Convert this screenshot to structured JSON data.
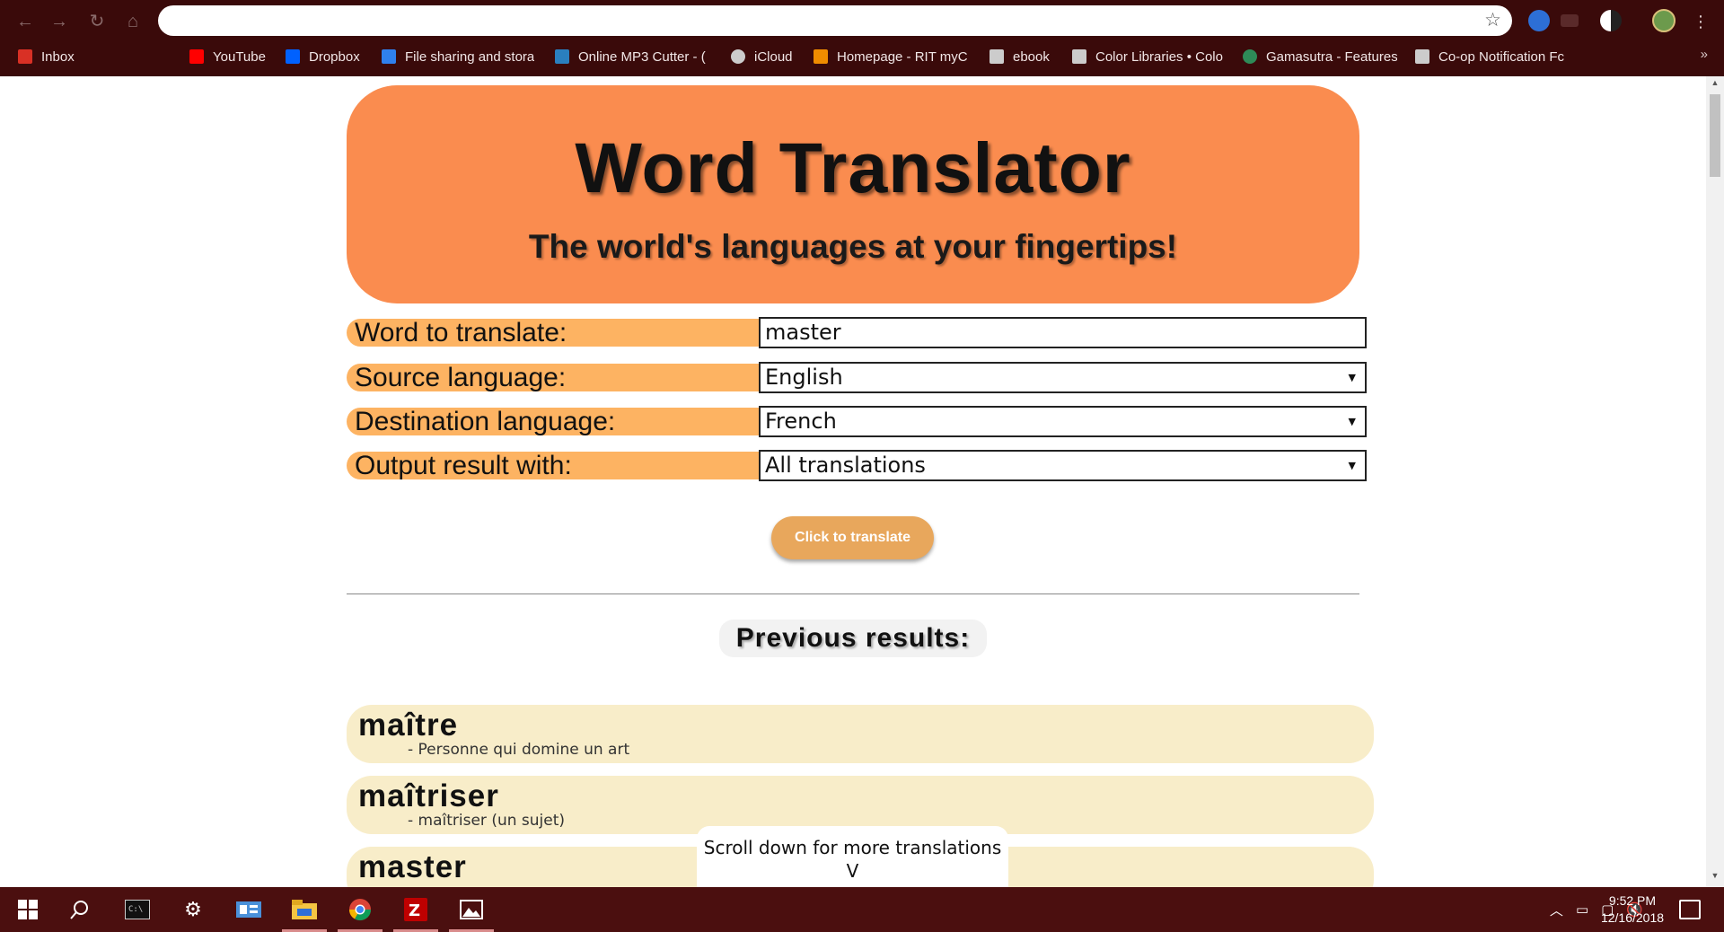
{
  "browser": {
    "url": "",
    "bookmarks": [
      {
        "label": "Inbox",
        "icon": "gmail-icon",
        "color": "#d93025"
      },
      {
        "label": "YouTube",
        "icon": "youtube-icon",
        "color": "#ff0000"
      },
      {
        "label": "Dropbox",
        "icon": "dropbox-icon",
        "color": "#0061ff"
      },
      {
        "label": "File sharing and stora",
        "icon": "file-sharing-icon",
        "color": "#2f80ed"
      },
      {
        "label": "Online MP3 Cutter - (",
        "icon": "mp3-cutter-icon",
        "color": "#2a7fbf"
      },
      {
        "label": "iCloud",
        "icon": "apple-icon",
        "color": "#cccccc"
      },
      {
        "label": "Homepage - RIT myC",
        "icon": "rit-icon",
        "color": "#f08c00"
      },
      {
        "label": "ebook",
        "icon": "page-icon",
        "color": "#cccccc"
      },
      {
        "label": "Color Libraries • Colo",
        "icon": "page-icon",
        "color": "#cccccc"
      },
      {
        "label": "Gamasutra - Features",
        "icon": "gamasutra-icon",
        "color": "#2e8b57"
      },
      {
        "label": "Co-op Notification Fc",
        "icon": "page-icon",
        "color": "#cccccc"
      }
    ],
    "more": "»"
  },
  "header": {
    "title": "Word Translator",
    "subtitle": "The world's languages at your fingertips!"
  },
  "form": {
    "word": {
      "label": "Word to translate:",
      "value": "master"
    },
    "source": {
      "label": "Source language:",
      "value": "English"
    },
    "destination": {
      "label": "Destination language:",
      "value": "French"
    },
    "output": {
      "label": "Output result with:",
      "value": "All translations"
    },
    "button_label": "Click to translate"
  },
  "results": {
    "heading": "Previous results:",
    "items": [
      {
        "word": "maître",
        "definition": "- Personne qui domine un art"
      },
      {
        "word": "maîtriser",
        "definition": "- maîtriser (un sujet)"
      },
      {
        "word": "master",
        "definition": ""
      }
    ]
  },
  "scroll_notice": {
    "line1": "Scroll down for more translations",
    "line2": "V"
  },
  "taskbar": {
    "time": "9:52 PM",
    "date": "12/16/2018"
  },
  "colors": {
    "header": "#fa8c4f",
    "label": "#fdb362",
    "button": "#e8a75c",
    "result": "#f8edc9",
    "chrome": "#3a0a0a",
    "taskbar": "#4b0f0f"
  }
}
